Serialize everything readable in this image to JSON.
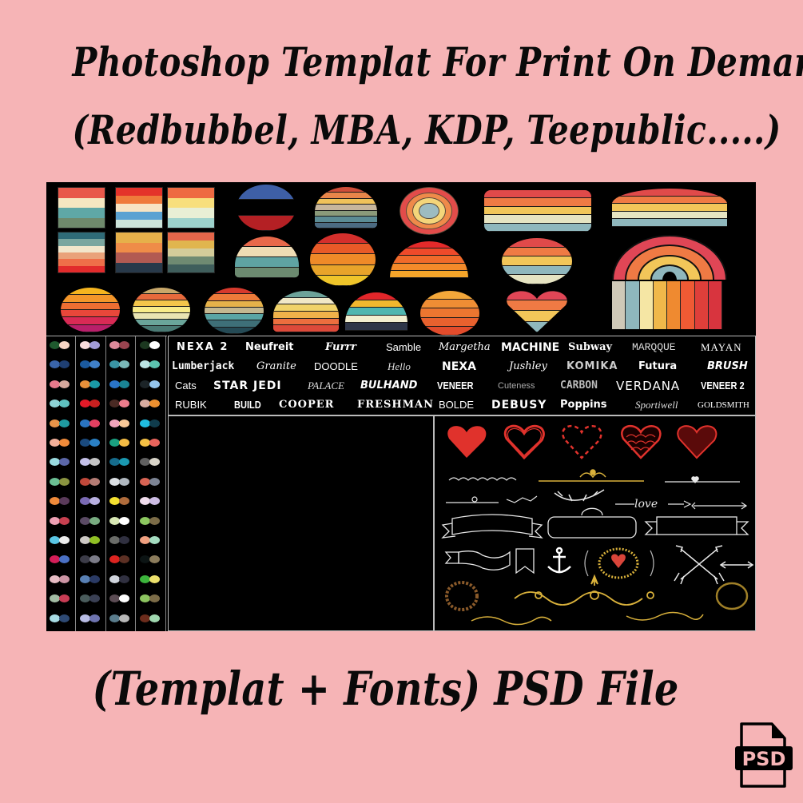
{
  "header": {
    "line1": "Photoshop Templat For Print On Demand",
    "line2": "(Redbubbel, MBA, KDP, Teepublic.....)"
  },
  "footer": {
    "text": "(Templat + Fonts) PSD File",
    "file_icon": "psd-file-icon",
    "file_icon_label": "PSD"
  },
  "colors": {
    "background": "#f6b4b6",
    "panel": "#000000",
    "text": "#0a0a0a",
    "ornament_red": "#e0322c",
    "ornament_gold": "#d9b13b",
    "ornament_white": "#e8e8e8"
  },
  "retro_squares": [
    [
      "#e8584a",
      "#f5e7c1",
      "#5fa8a6",
      "#6f8a6c"
    ],
    [
      "#e4322a",
      "#ef7a3b",
      "#f7e4c3",
      "#5aa2d2",
      "#cce3da"
    ],
    [
      "#ee6a42",
      "#f8df7c",
      "#e8efd5",
      "#9dd2cc"
    ],
    [
      "#2f6b77",
      "#7aa69f",
      "#f2e6cb",
      "#e9a27a",
      "#ef6f49",
      "#e22b2c"
    ],
    [
      "#e6b04a",
      "#ef8c48",
      "#b25a52",
      "#28394a"
    ],
    [
      "#e4664a",
      "#e0b54e",
      "#d4cc9a",
      "#6f8a72",
      "#3f5e5c"
    ]
  ],
  "retro_shapes": [
    {
      "name": "usa-flag-sunset",
      "stripes": [
        "#3e5fa6",
        "#000000",
        "#b42024"
      ]
    },
    {
      "name": "muted-sunset",
      "stripes": [
        "#cf4e3a",
        "#e8854a",
        "#f0c25a",
        "#c7b69d",
        "#8a9a7a",
        "#5b8b94",
        "#4c6b82"
      ]
    },
    {
      "name": "target-circle",
      "stripes": [
        "#e24c4a",
        "#ef8a4a",
        "#f4d57a",
        "#9dbcc1"
      ]
    },
    {
      "name": "banner-circle",
      "stripes": [
        "#e04a4a",
        "#ef7a44",
        "#f2c659",
        "#e6e4c2",
        "#8fb7bd"
      ]
    },
    {
      "name": "wide-banner-sun",
      "stripes": [
        "#e04a4a",
        "#ef7a44",
        "#f2c659",
        "#e6e4c2",
        "#8fb7bd"
      ]
    },
    {
      "name": "half-circle-sunset",
      "stripes": [
        "#e8684a",
        "#efdcb4",
        "#5fa3a2",
        "#6c8a70"
      ]
    },
    {
      "name": "grunge-sunset",
      "stripes": [
        "#d42f2c",
        "#e85a28",
        "#ef8a28",
        "#e8a42a",
        "#efc52a"
      ]
    },
    {
      "name": "horizon-sunset",
      "stripes": [
        "#e42a2a",
        "#ef4a2a",
        "#f06a2a",
        "#f38a2a",
        "#f5a52a"
      ]
    },
    {
      "name": "distressed-circle",
      "stripes": [
        "#e04a4a",
        "#ef7a44",
        "#f2c659",
        "#8fb7bd",
        "#e6e4c2"
      ]
    },
    {
      "name": "rainbow",
      "stripes": [
        "#e04656",
        "#ef7a44",
        "#f2c659",
        "#8fb7bd"
      ]
    },
    {
      "name": "vertical-stripes",
      "stripes": [
        "#cfc9b8",
        "#8fb7bd",
        "#f5e6a4",
        "#f0b84a",
        "#ef8a30",
        "#ef5a34",
        "#df3f3a",
        "#d8343e"
      ]
    },
    {
      "name": "gradient-sunset",
      "stripes": [
        "#f5b51f",
        "#f3962a",
        "#ee6e32",
        "#e8473a",
        "#d92a55",
        "#b91f6a"
      ]
    },
    {
      "name": "vintage-sunset",
      "stripes": [
        "#c9a86a",
        "#e76a3c",
        "#f3c64a",
        "#f7ec8a",
        "#e8e4b2",
        "#6aa59a",
        "#4a7a74"
      ]
    },
    {
      "name": "dark-sunset",
      "stripes": [
        "#d73a2d",
        "#ee7b3a",
        "#e6b24a",
        "#c4b891",
        "#5aa5a5",
        "#3e6f78",
        "#254a55"
      ]
    },
    {
      "name": "cool-sunset",
      "stripes": [
        "#6da39a",
        "#f0e8c7",
        "#f0d36a",
        "#f0b24a",
        "#ec6e3e",
        "#dd4a3a"
      ]
    },
    {
      "name": "bold-sunset",
      "stripes": [
        "#e2262a",
        "#f2b82e",
        "#4fb6b0",
        "#f2efd0",
        "#2e3648"
      ]
    },
    {
      "name": "orange-sunset",
      "stripes": [
        "#f3a73a",
        "#ef8d34",
        "#ec7630",
        "#e8612e",
        "#e24c2c"
      ]
    },
    {
      "name": "heart-sunset",
      "stripes": [
        "#e04656",
        "#ef7a44",
        "#f2c659",
        "#8fb7bd"
      ]
    }
  ],
  "palettes": [
    [
      [
        "#1f5a2e",
        "#f7d5c4"
      ],
      [
        "#3a64a8",
        "#1f3f72"
      ],
      [
        "#e87a8c",
        "#d7a99e"
      ],
      [
        "#8fd3d6",
        "#5fc1c0"
      ],
      [
        "#e8944a",
        "#1f9aa0"
      ],
      [
        "#f2b09a",
        "#ef8a3a"
      ],
      [
        "#9adbe0",
        "#5b66a8"
      ],
      [
        "#6bbf94",
        "#8a9440"
      ],
      [
        "#ef8a3a",
        "#5a3a5a"
      ],
      [
        "#eea0b4",
        "#c84050"
      ],
      [
        "#5ac6e4",
        "#ececec"
      ],
      [
        "#d41e58",
        "#4a70c4"
      ],
      [
        "#e6bcc4",
        "#cc94a4"
      ],
      [
        "#a2bca4",
        "#c83c54"
      ],
      [
        "#a8dce4",
        "#2e4a74"
      ]
    ],
    [
      [
        "#f9dcdc",
        "#a19cd8"
      ],
      [
        "#1b5a9f",
        "#4080c8"
      ],
      [
        "#e8903a",
        "#1a9aa6"
      ],
      [
        "#e21a28",
        "#c82020"
      ],
      [
        "#2a74c0",
        "#e44060"
      ],
      [
        "#1a4a7e",
        "#2a80c4"
      ],
      [
        "#c4c0e8",
        "#c4c4c4"
      ],
      [
        "#c0483a",
        "#b47c74"
      ],
      [
        "#7a6ab4",
        "#b8b0e0"
      ],
      [
        "#5a4a64",
        "#78ac80"
      ],
      [
        "#ccc8c4",
        "#90c024"
      ],
      [
        "#3c3c48",
        "#7c7c88"
      ],
      [
        "#5880b4",
        "#2a3a64"
      ],
      [
        "#4a5c5c",
        "#3a4054"
      ],
      [
        "#b8bce4",
        "#6e74b0"
      ]
    ],
    [
      [
        "#dc8a9a",
        "#9a4450"
      ],
      [
        "#3a94a4",
        "#7ab8b8"
      ],
      [
        "#2a74c8",
        "#1a8494"
      ],
      [
        "#4a2a24",
        "#ec7c8c"
      ],
      [
        "#f0a4bc",
        "#f8c898"
      ],
      [
        "#1aa080",
        "#f4bc44"
      ],
      [
        "#166c8c",
        "#1a98b0"
      ],
      [
        "#dce0e4",
        "#b0b8c0"
      ],
      [
        "#f4e030",
        "#b06c3c"
      ],
      [
        "#d8e8b4",
        "#ffffff"
      ],
      [
        "#6a6c68",
        "#303040"
      ],
      [
        "#dc2420",
        "#5c3024"
      ],
      [
        "#d0d4dc",
        "#303040"
      ],
      [
        "#5c4c54",
        "#ffffff"
      ],
      [
        "#5a7c8c",
        "#b8b8b8"
      ]
    ],
    [
      [
        "#1c3820",
        "#ffffff"
      ],
      [
        "#bce4e4",
        "#5cc4b0"
      ],
      [
        "#1c2428",
        "#94c4ec"
      ],
      [
        "#d8aca0",
        "#ec9030"
      ],
      [
        "#20bce0",
        "#103c4c"
      ],
      [
        "#f4c044",
        "#e8645c"
      ],
      [
        "#606060",
        "#d8d4c8"
      ],
      [
        "#d86454",
        "#7c8494"
      ],
      [
        "#f0dcec",
        "#ccbce4"
      ],
      [
        "#8cc860",
        "#7c6c48"
      ],
      [
        "#f0a080",
        "#a4dcc0"
      ],
      [
        "#0c1414",
        "#8c7c5c"
      ],
      [
        "#3cb43c",
        "#ece06c"
      ],
      [
        "#8cc460",
        "#7c6c48"
      ],
      [
        "#6c2c1c",
        "#a0d8b0"
      ]
    ]
  ],
  "fonts": [
    [
      {
        "label": "NEXA 2",
        "style": "bold-wide"
      },
      {
        "label": "Neufreit",
        "style": "bold"
      },
      {
        "label": "Furrr",
        "style": "blackletter"
      },
      {
        "label": "Samble",
        "style": "light"
      },
      {
        "label": "Margetha",
        "style": "script"
      },
      {
        "label": "MACHINE",
        "style": "heavy"
      },
      {
        "label": "Subway",
        "style": "bold-serif"
      },
      {
        "label": "MARQQUE",
        "style": "mono-light"
      },
      {
        "label": "MAYAN",
        "style": "serif-light"
      }
    ],
    [
      {
        "label": "Lumberjack",
        "style": "mono-bold"
      },
      {
        "label": "Granite",
        "style": "script"
      },
      {
        "label": "DOODLE",
        "style": "light"
      },
      {
        "label": "Hello",
        "style": "script-light"
      },
      {
        "label": "NEXA",
        "style": "heavy"
      },
      {
        "label": "Jushley",
        "style": "script"
      },
      {
        "label": "KOMIKA",
        "style": "comic"
      },
      {
        "label": "Futura",
        "style": "bold"
      },
      {
        "label": "BRUSH",
        "style": "brush"
      }
    ],
    [
      {
        "label": "Cats",
        "style": "light"
      },
      {
        "label": "STAR JEDI",
        "style": "heavy-wide"
      },
      {
        "label": "PALACE",
        "style": "script-light"
      },
      {
        "label": "BULHAND",
        "style": "brush"
      },
      {
        "label": "VENEER",
        "style": "condensed"
      },
      {
        "label": "Cuteness",
        "style": "thin"
      },
      {
        "label": "CARBON",
        "style": "condensed-light"
      },
      {
        "label": "VERDANA",
        "style": "regular-wide"
      },
      {
        "label": "VENEER 2",
        "style": "condensed"
      }
    ],
    [
      {
        "label": "RUBIK",
        "style": "light"
      },
      {
        "label": "BUILD",
        "style": "condensed"
      },
      {
        "label": "COOPER",
        "style": "serif-heavy"
      },
      {
        "label": "FRESHMAN",
        "style": "serif-heavy"
      },
      {
        "label": "BOLDE",
        "style": "light"
      },
      {
        "label": "DEBUSY",
        "style": "heavy-wide"
      },
      {
        "label": "Poppins",
        "style": "bold"
      },
      {
        "label": "Sportiwell",
        "style": "script-light"
      },
      {
        "label": "GOLDSMITH",
        "style": "smallcaps"
      }
    ]
  ],
  "ornaments": {
    "hearts": [
      "scribble-heart-icon",
      "outline-heart-icon",
      "dashed-heart-icon",
      "pattern-heart-icon",
      "crosshatch-heart-icon"
    ],
    "dividers": [
      "beaded-divider",
      "gold-flourish-divider",
      "arrow-heart-divider",
      "leaf-divider",
      "branch-divider",
      "love-arrow-divider",
      "feather-arrow-divider"
    ],
    "banners": [
      "ribbon-banner",
      "ornate-frame-banner",
      "box-ribbon-banner",
      "wavy-ribbon-banner",
      "pennant-banner"
    ],
    "icons": [
      "anchor-icon",
      "laurel-icon",
      "heart-wreath-icon",
      "crossed-arrows-icon",
      "arrow-icon"
    ],
    "wreaths": [
      "floral-wreath-icon",
      "gold-wreath-icon"
    ],
    "flourishes": [
      "gold-scroll-flourish",
      "gold-swirl-flourish-left",
      "gold-swirl-flourish-right"
    ],
    "love_text": "love"
  }
}
